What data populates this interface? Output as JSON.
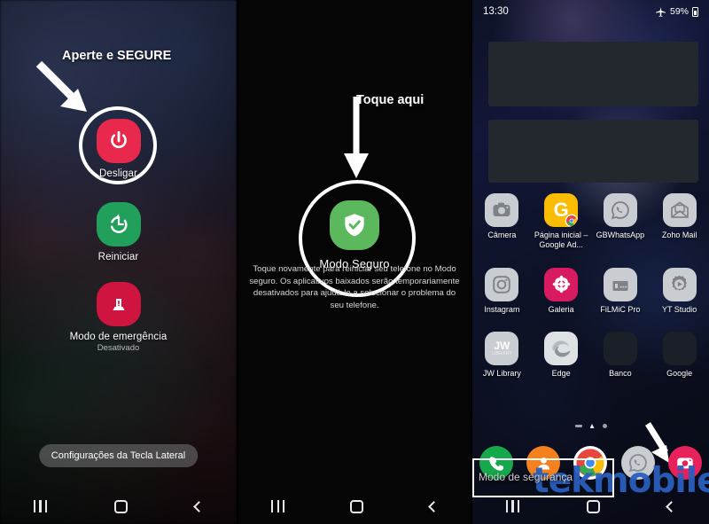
{
  "panel_power_menu": {
    "annotation": "Aperte e SEGURE",
    "items": [
      {
        "label": "Desligar",
        "sub": "",
        "icon": "power-icon",
        "color": "#e8284c"
      },
      {
        "label": "Reiniciar",
        "sub": "",
        "icon": "restart-icon",
        "color": "#21a05b"
      },
      {
        "label": "Modo de emergência",
        "sub": "Desativado",
        "icon": "emergency-beacon-icon",
        "color": "#cf1440"
      }
    ],
    "side_key_button": "Configurações da Tecla Lateral"
  },
  "panel_safe_mode": {
    "annotation": "Toque aqui",
    "title": "Modo Seguro",
    "icon": "shield-check-icon",
    "icon_color": "#5cb85c",
    "description": "Toque novamente para reiniciar seu telefone no Modo seguro. Os aplicativos baixados serão temporariamente desativados para ajudá-lo a solucionar o problema do seu telefone."
  },
  "panel_home": {
    "status_bar": {
      "time": "13:30",
      "airplane_icon": "airplane-mode-icon",
      "battery_percent": "59%",
      "battery_icon": "battery-icon"
    },
    "apps": [
      [
        {
          "label": "Câmera",
          "icon": "camera-app-icon"
        },
        {
          "label": "Página inicial – Google Ad...",
          "icon": "google-ads-icon"
        },
        {
          "label": "GBWhatsApp",
          "icon": "whatsapp-icon"
        },
        {
          "label": "Zoho Mail",
          "icon": "zoho-mail-icon"
        }
      ],
      [
        {
          "label": "Instagram",
          "icon": "instagram-icon"
        },
        {
          "label": "Galeria",
          "icon": "gallery-icon"
        },
        {
          "label": "FiLMiC Pro",
          "icon": "filmic-pro-icon"
        },
        {
          "label": "YT Studio",
          "icon": "yt-studio-icon"
        }
      ],
      [
        {
          "label": "JW Library",
          "icon": "jw-library-icon"
        },
        {
          "label": "Edge",
          "icon": "edge-icon"
        },
        {
          "label": "Banco",
          "icon": "folder-banco-icon"
        },
        {
          "label": "Google",
          "icon": "folder-google-icon"
        }
      ]
    ],
    "page_indicator": {
      "pages": 3,
      "current": 1
    },
    "dock": [
      {
        "label": "Telefone",
        "icon": "phone-icon"
      },
      {
        "label": "Contatos",
        "icon": "contacts-icon"
      },
      {
        "label": "Chrome",
        "icon": "chrome-icon"
      },
      {
        "label": "WhatsApp",
        "icon": "whatsapp-dock-icon"
      },
      {
        "label": "Câmera",
        "icon": "camera-dock-icon"
      }
    ],
    "safe_mode_badge": "Modo de segurança",
    "watermark": "tekmobile"
  },
  "nav_bar": {
    "recents": "recents-icon",
    "home": "home-icon",
    "back": "back-icon"
  },
  "colors": {
    "accent_red": "#e8284c",
    "accent_green": "#21a05b",
    "accent_crimson": "#cf1440",
    "safe_green": "#5cb85c",
    "watermark_blue": "#2a5fbe"
  }
}
